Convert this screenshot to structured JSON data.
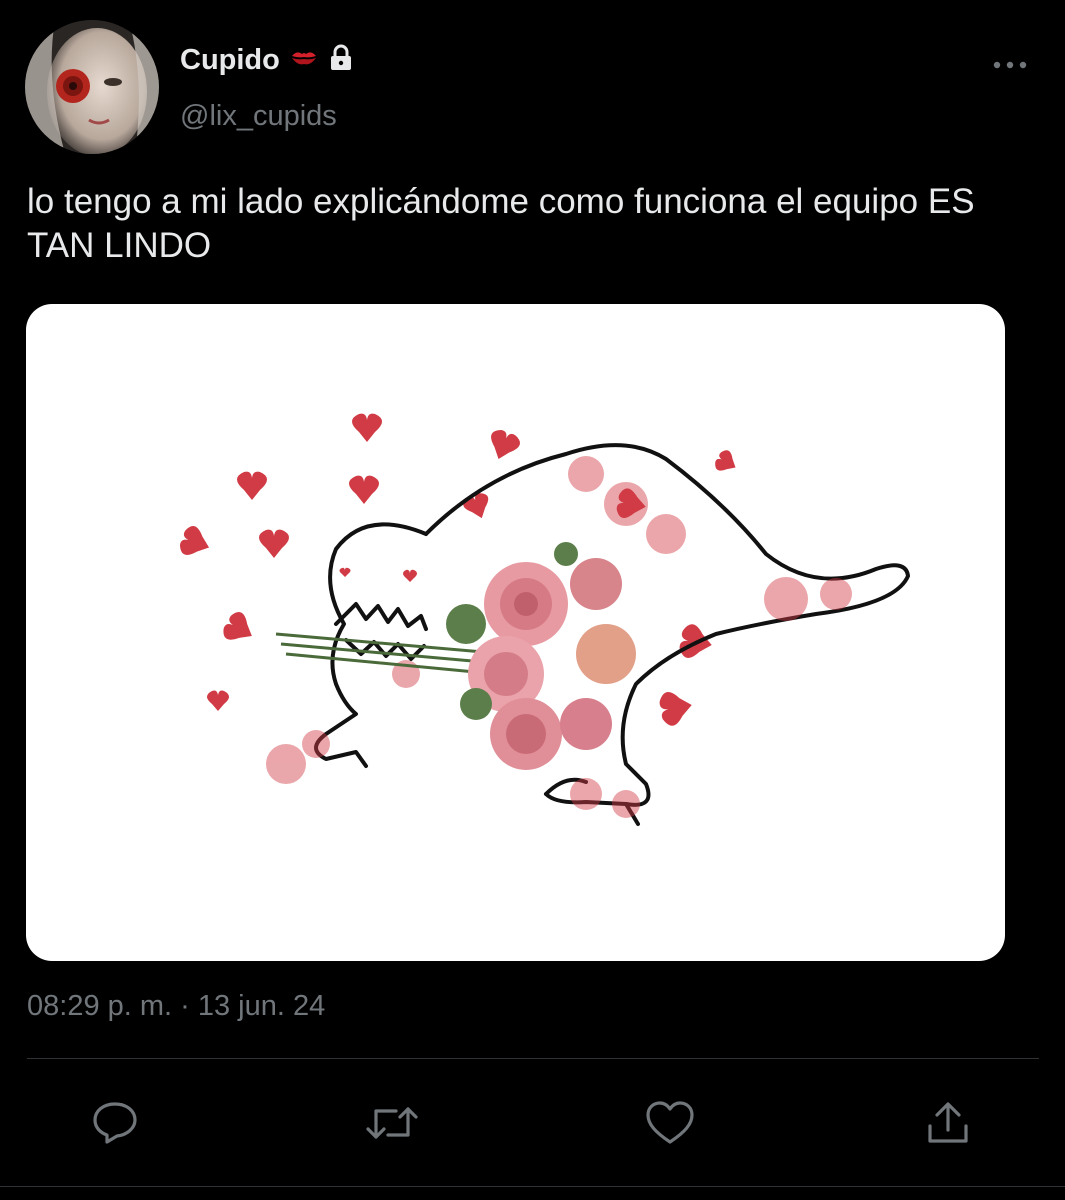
{
  "user": {
    "display_name": "Cupido",
    "handle": "@lix_cupids",
    "emoji_icon": "kiss-mark-icon",
    "badge_icon": "lock-icon"
  },
  "tweet": {
    "text": "lo tengo a mi lado explicándome como funciona el equipo ES TAN LINDO",
    "timestamp": "08:29 p. m. · 13 jun. 24"
  },
  "actions": [
    {
      "icon": "reply-icon"
    },
    {
      "icon": "retweet-icon"
    },
    {
      "icon": "like-icon"
    },
    {
      "icon": "share-icon"
    }
  ],
  "colors": {
    "background": "#000000",
    "text_primary": "#e7e9ea",
    "text_secondary": "#71767b",
    "divider": "#2f3336",
    "heart_red": "#d13b45"
  }
}
